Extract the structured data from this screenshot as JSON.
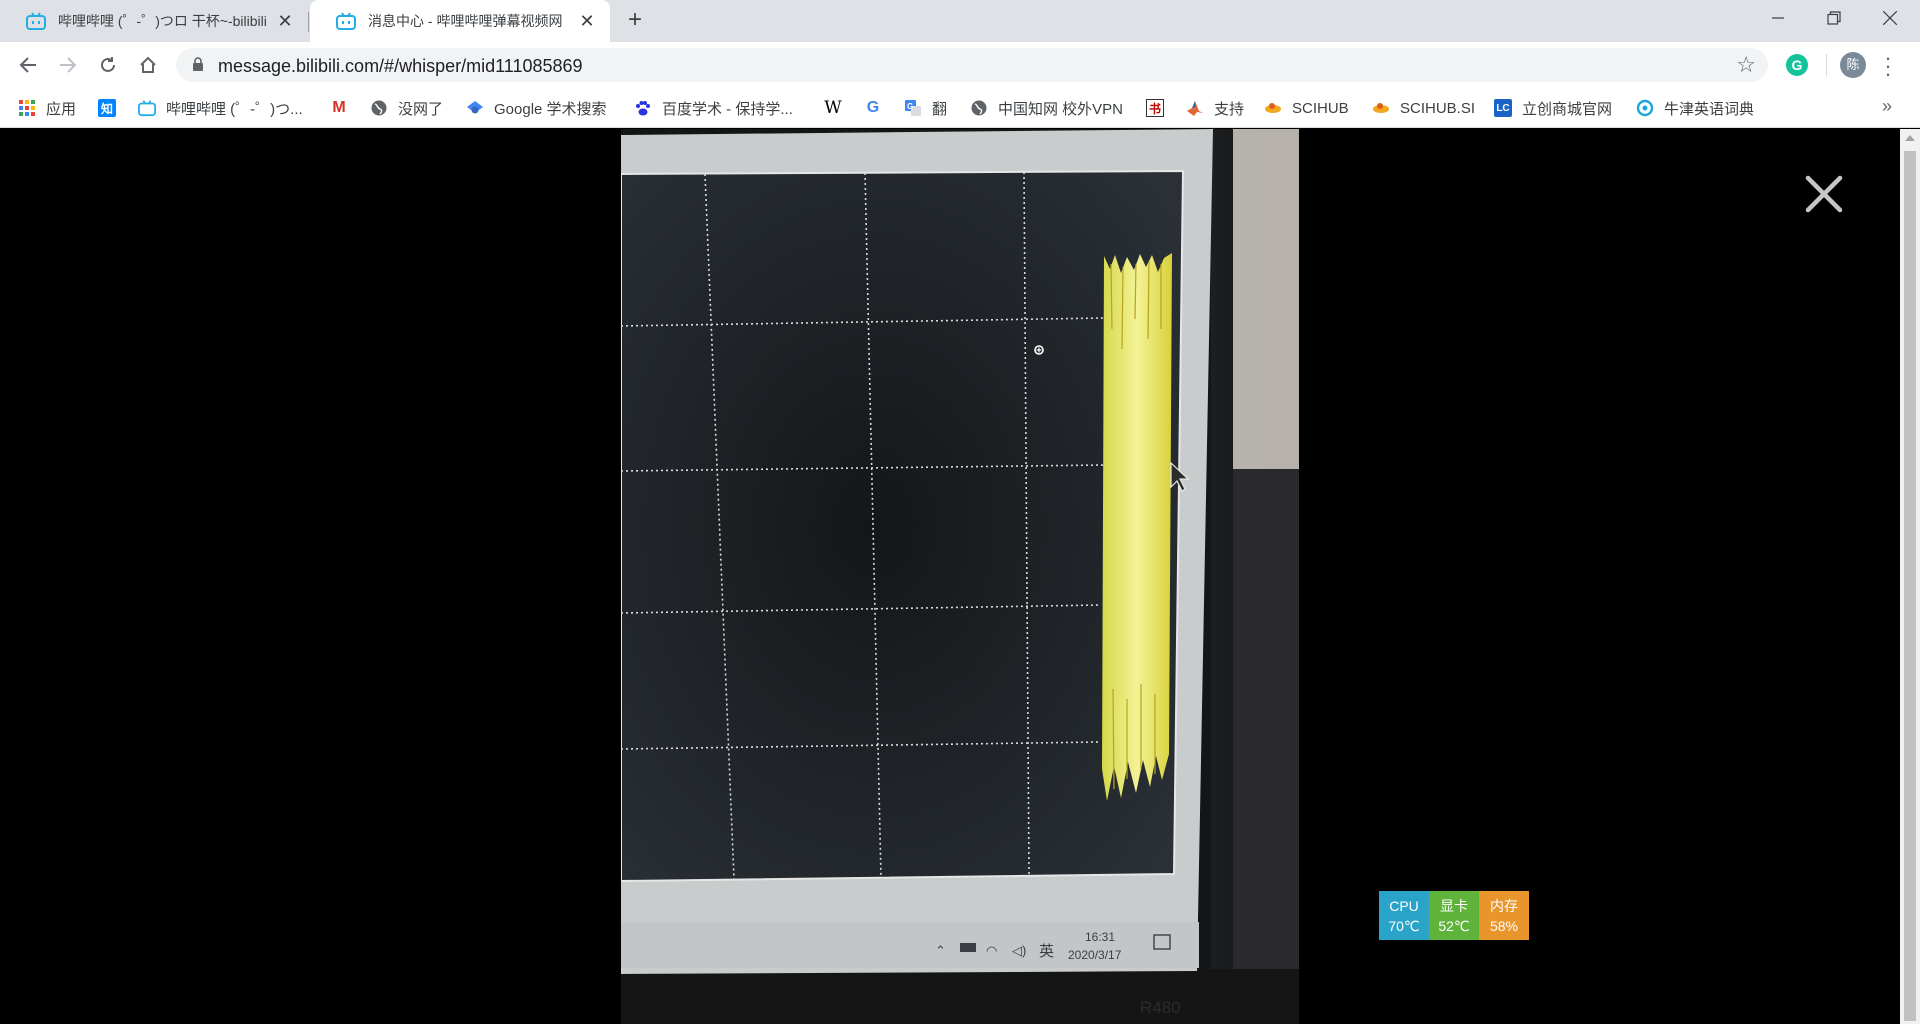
{
  "browser": {
    "tabs": [
      {
        "title": "哔哩哔哩 (゜-゜)つロ 干杯~-bilibili",
        "active": false
      },
      {
        "title": "消息中心 - 哔哩哔哩弹幕视频网",
        "active": true
      }
    ],
    "new_tab_label": "+",
    "address": "message.bilibili.com/#/whisper/mid111085869"
  },
  "bookmarks": [
    {
      "label": "应用",
      "icon": "apps-grid-icon"
    },
    {
      "label": "",
      "icon": "zhihu-icon",
      "glyph": "知"
    },
    {
      "label": "哔哩哔哩 (゜-゜)つ...",
      "icon": "bilibili-icon"
    },
    {
      "label": "",
      "icon": "gmail-icon",
      "glyph": "M"
    },
    {
      "label": "没网了",
      "icon": "globe-icon"
    },
    {
      "label": "Google 学术搜索",
      "icon": "google-scholar-icon"
    },
    {
      "label": "百度学术 - 保持学...",
      "icon": "baidu-paw-icon"
    },
    {
      "label": "",
      "icon": "wikipedia-icon",
      "glyph": "W"
    },
    {
      "label": "",
      "icon": "google-icon",
      "glyph": "G"
    },
    {
      "label": "翻",
      "icon": "translate-icon"
    },
    {
      "label": "中国知网 校外VPN",
      "icon": "globe-icon"
    },
    {
      "label": "",
      "icon": "calligraphy-icon",
      "glyph": "书"
    },
    {
      "label": "支持",
      "icon": "matlab-icon"
    },
    {
      "label": "SCIHUB",
      "icon": "scihub-icon"
    },
    {
      "label": "SCIHUB.SI",
      "icon": "scihub-icon"
    },
    {
      "label": "立创商城官网",
      "icon": "lc-icon",
      "glyph": "LC"
    },
    {
      "label": "牛津英语词典",
      "icon": "oxford-icon"
    }
  ],
  "bookmarks_more": "»",
  "profile_initial": "陈",
  "photo": {
    "taskbar_time": "16:31",
    "taskbar_date": "2020/3/17",
    "taskbar_ime": "英",
    "bezel_label": "R480"
  },
  "monitor": [
    {
      "label": "CPU",
      "value": "70℃",
      "color": "#2aa3c8"
    },
    {
      "label": "显卡",
      "value": "52℃",
      "color": "#5fb33a"
    },
    {
      "label": "内存",
      "value": "58%",
      "color": "#e8962b"
    }
  ]
}
